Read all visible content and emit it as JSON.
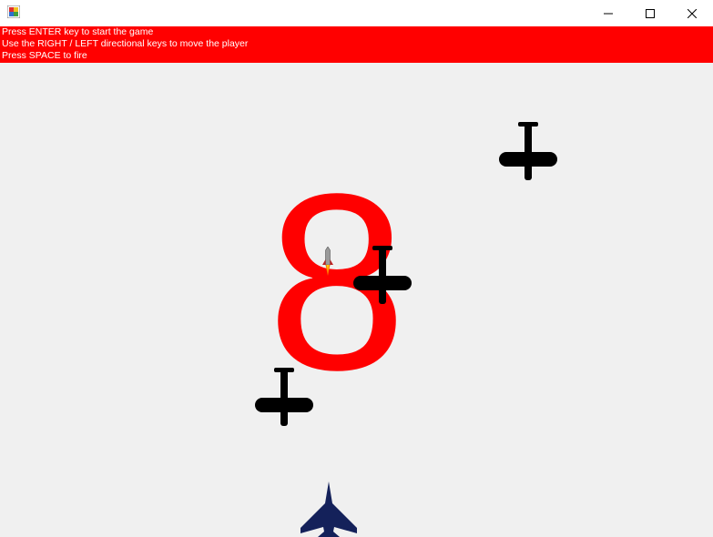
{
  "window": {
    "minimize_icon": "minimize-icon",
    "maximize_icon": "maximize-icon",
    "close_icon": "close-icon"
  },
  "instructions": {
    "line1": "Press ENTER key to start the game",
    "line2": "Use the RIGHT / LEFT directional keys to move the player",
    "line3": "Press SPACE to fire",
    "background": "#ff0000",
    "text_color": "#ffffff"
  },
  "game": {
    "score": "8",
    "score_color": "#ff0000",
    "background": "#f0f0f0",
    "enemy_color": "#000000",
    "player_color": "#14215a",
    "sprites": {
      "enemies": [
        "enemy-plane-icon",
        "enemy-plane-icon",
        "enemy-plane-icon"
      ],
      "player": "player-jet-icon",
      "missile": "missile-icon"
    }
  }
}
